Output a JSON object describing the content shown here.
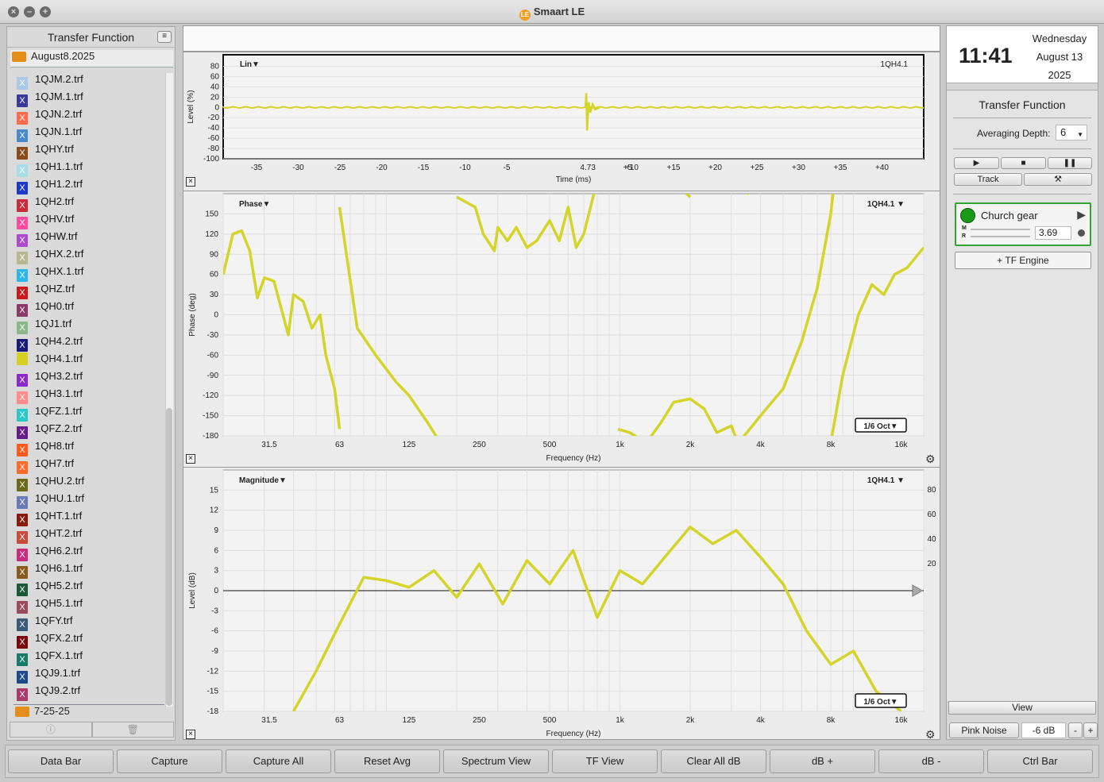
{
  "window": {
    "title": "Smaart LE",
    "logo_text": "LE"
  },
  "sidebar": {
    "header": "Transfer Function",
    "folder": "August8.2025",
    "folder2": "7-25-25",
    "files": [
      {
        "name": "1QJM.2.trf",
        "color": "#a8c8e8"
      },
      {
        "name": "1QJM.1.trf",
        "color": "#3a3a9a"
      },
      {
        "name": "1QJN.2.trf",
        "color": "#ff6b4a"
      },
      {
        "name": "1QJN.1.trf",
        "color": "#4a8acc"
      },
      {
        "name": "1QHY.trf",
        "color": "#8b4a1a"
      },
      {
        "name": "1QH1.1.trf",
        "color": "#a8dce8"
      },
      {
        "name": "1QH1.2.trf",
        "color": "#1a3acc"
      },
      {
        "name": "1QH2.trf",
        "color": "#cc2a3a"
      },
      {
        "name": "1QHV.trf",
        "color": "#ff4aa0"
      },
      {
        "name": "1QHW.trf",
        "color": "#aa4acc"
      },
      {
        "name": "1QHX.2.trf",
        "color": "#b8b890"
      },
      {
        "name": "1QHX.1.trf",
        "color": "#2ab8e8"
      },
      {
        "name": "1QHZ.trf",
        "color": "#cc1a1a"
      },
      {
        "name": "1QH0.trf",
        "color": "#8a3a6a"
      },
      {
        "name": "1QJ1.trf",
        "color": "#8ab88a"
      },
      {
        "name": "1QH4.2.trf",
        "color": "#1a1a7a"
      },
      {
        "name": "1QH4.1.trf",
        "color": "#d8d020"
      },
      {
        "name": "1QH3.2.trf",
        "color": "#8a2acc"
      },
      {
        "name": "1QH3.1.trf",
        "color": "#ff8a8a"
      },
      {
        "name": "1QFZ.1.trf",
        "color": "#2ac8c8"
      },
      {
        "name": "1QFZ.2.trf",
        "color": "#6a1a8a"
      },
      {
        "name": "1QH8.trf",
        "color": "#ff5a1a"
      },
      {
        "name": "1QH7.trf",
        "color": "#ff6a2a"
      },
      {
        "name": "1QHU.2.trf",
        "color": "#6a6a1a"
      },
      {
        "name": "1QHU.1.trf",
        "color": "#6a7ab8"
      },
      {
        "name": "1QHT.1.trf",
        "color": "#8a1a0a"
      },
      {
        "name": "1QHT.2.trf",
        "color": "#cc4a3a"
      },
      {
        "name": "1QH6.2.trf",
        "color": "#cc2a7a"
      },
      {
        "name": "1QH6.1.trf",
        "color": "#8a5a1a"
      },
      {
        "name": "1QH5.2.trf",
        "color": "#1a5a3a"
      },
      {
        "name": "1QH5.1.trf",
        "color": "#9a4a5a"
      },
      {
        "name": "1QFY.trf",
        "color": "#3a5a7a"
      },
      {
        "name": "1QFX.2.trf",
        "color": "#7a0a0a"
      },
      {
        "name": "1QFX.1.trf",
        "color": "#1a7a6a"
      },
      {
        "name": "1QJ9.1.trf",
        "color": "#1a4a8a"
      },
      {
        "name": "1QJ9.2.trf",
        "color": "#aa3a6a"
      }
    ],
    "bottom_icons": [
      "info-icon",
      "trash-icon"
    ]
  },
  "impulse": {
    "title": "Lin▼",
    "trace_label": "1QH4.1",
    "ylabel": "Level (%)",
    "xlabel": "Time (ms)",
    "yticks": [
      "80",
      "60",
      "40",
      "20",
      "0",
      "-20",
      "-40",
      "-60",
      "-80",
      "-100"
    ],
    "xticks": [
      "-35",
      "-30",
      "-25",
      "-20",
      "-15",
      "-10",
      "-5",
      "4.73",
      "+5",
      "+10",
      "+15",
      "+20",
      "+25",
      "+30",
      "+35",
      "+40"
    ]
  },
  "phase": {
    "title": "Phase▼",
    "trace_label": "1QH4.1 ▼",
    "ylabel": "Phase (deg)",
    "xlabel": "Frequency (Hz)",
    "smoothing": "1/6 Oct▼",
    "yticks": [
      "150",
      "120",
      "90",
      "60",
      "30",
      "0",
      "-30",
      "-60",
      "-90",
      "-120",
      "-150",
      "-180"
    ],
    "xticks": [
      "31.5",
      "63",
      "125",
      "250",
      "500",
      "1k",
      "2k",
      "4k",
      "8k",
      "16k"
    ]
  },
  "magnitude": {
    "title": "Magnitude▼",
    "trace_label": "1QH4.1 ▼",
    "ylabel": "Level (dB)",
    "xlabel": "Frequency (Hz)",
    "smoothing": "1/6 Oct▼",
    "yticks": [
      "15",
      "12",
      "9",
      "6",
      "3",
      "0",
      "-3",
      "-6",
      "-9",
      "-12",
      "-15",
      "-18"
    ],
    "rticks": [
      "80",
      "60",
      "40",
      "20"
    ],
    "xticks": [
      "31.5",
      "63",
      "125",
      "250",
      "500",
      "1k",
      "2k",
      "4k",
      "8k",
      "16k"
    ]
  },
  "chart_data": [
    {
      "type": "line",
      "title": "Lin",
      "xlabel": "Time (ms)",
      "ylabel": "Level (%)",
      "xlim": [
        -39,
        45
      ],
      "ylim": [
        -100,
        90
      ],
      "series": [
        {
          "name": "1QH4.1",
          "color": "#d4d42a",
          "x": [
            -39,
            -10,
            2,
            4,
            4.73,
            5,
            6,
            7,
            8,
            10,
            20,
            30,
            40,
            45
          ],
          "y": [
            0,
            0,
            1,
            5,
            20,
            -30,
            10,
            -8,
            5,
            1,
            0,
            0,
            0,
            0
          ]
        }
      ]
    },
    {
      "type": "line",
      "title": "Phase",
      "xlabel": "Frequency (Hz)",
      "ylabel": "Phase (deg)",
      "ylim": [
        -180,
        180
      ],
      "xscale": "log",
      "series": [
        {
          "name": "1QH4.1",
          "color": "#d4d42a"
        }
      ]
    },
    {
      "type": "line",
      "title": "Magnitude",
      "xlabel": "Frequency (Hz)",
      "ylabel": "Level (dB)",
      "ylim": [
        -18,
        18
      ],
      "xscale": "log",
      "series": [
        {
          "name": "1QH4.1",
          "color": "#d4d42a",
          "x": [
            40,
            50,
            63,
            80,
            100,
            125,
            160,
            200,
            250,
            315,
            400,
            500,
            630,
            800,
            1000,
            1250,
            1600,
            2000,
            2500,
            3150,
            4000,
            5000,
            6300,
            8000,
            10000,
            12500,
            16000
          ],
          "y": [
            -18,
            -12,
            -5,
            2,
            1.5,
            0.5,
            3,
            -1,
            4,
            -2,
            4.5,
            1,
            6,
            -4,
            3,
            1,
            5.5,
            9.5,
            7,
            9,
            5,
            1,
            -6,
            -11,
            -9,
            -15,
            -18
          ]
        }
      ]
    }
  ],
  "clock": {
    "time": "11:41",
    "weekday": "Wednesday",
    "date": "August 13",
    "year": "2025"
  },
  "right": {
    "section_title": "Transfer Function",
    "avg_label": "Averaging Depth:",
    "avg_value": "6",
    "track_label": "Track",
    "engine_name": "Church gear",
    "meter_m": "M",
    "meter_r": "R",
    "delay_value": "3.69",
    "tf_engine_label": "+ TF Engine",
    "view_label": "View",
    "pink_noise_label": "Pink Noise",
    "level_value": "-6 dB",
    "minus": "-",
    "plus": "+"
  },
  "bottom_buttons": [
    "Data Bar",
    "Capture",
    "Capture All",
    "Reset Avg",
    "Spectrum View",
    "TF View",
    "Clear All dB",
    "dB +",
    "dB -",
    "Ctrl Bar"
  ],
  "colors": {
    "trace": "#d4d42a",
    "accent_green": "#1a9a1a",
    "grid": "#dcdcdc"
  }
}
